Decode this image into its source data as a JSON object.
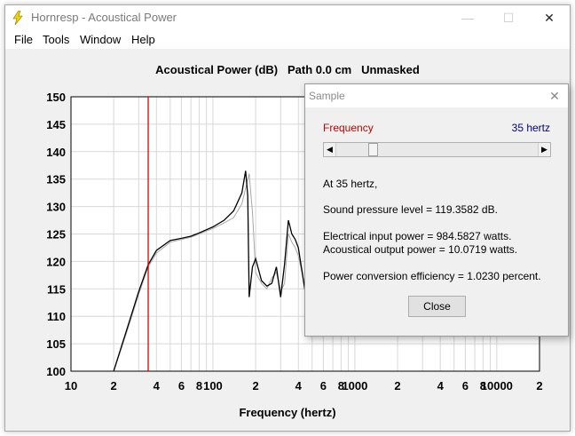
{
  "window": {
    "title": "Hornresp - Acoustical Power",
    "icon": "lightning-icon",
    "controls": {
      "minimize": "—",
      "maximize": "☐",
      "close": "✕"
    }
  },
  "menu": [
    "File",
    "Tools",
    "Window",
    "Help"
  ],
  "chart": {
    "title": "Acoustical Power (dB)   Path 0.0 cm   Unmasked",
    "xlabel": "Frequency (hertz)",
    "ylabel": "",
    "y_ticks": [
      "150",
      "145",
      "140",
      "135",
      "130",
      "125",
      "120",
      "115",
      "110",
      "105",
      "100"
    ],
    "x_ticks": [
      "10",
      "2",
      "4",
      "6",
      "8",
      "100",
      "2",
      "4",
      "6",
      "8",
      "1000",
      "2",
      "4",
      "6",
      "8",
      "10000",
      "2"
    ],
    "cursor_color": "#e00000"
  },
  "chart_data": {
    "type": "line",
    "title": "Acoustical Power (dB)   Path 0.0 cm   Unmasked",
    "xlabel": "Frequency (hertz)",
    "ylabel": "",
    "x_scale": "log",
    "xlim": [
      10,
      20000
    ],
    "ylim": [
      100,
      150
    ],
    "grid": true,
    "cursor_x": 35,
    "series": [
      {
        "color": "#000000",
        "x": [
          20,
          25,
          30,
          35,
          40,
          50,
          60,
          70,
          80,
          100,
          120,
          140,
          160,
          170,
          176,
          180,
          190,
          200,
          220,
          240,
          260,
          280,
          300,
          320,
          340,
          360,
          380,
          400,
          450,
          500
        ],
        "y": [
          100,
          108,
          114.5,
          119.4,
          122,
          123.8,
          124.2,
          124.6,
          125.2,
          126.3,
          127.5,
          129.2,
          132.5,
          136.5,
          132,
          113.5,
          119,
          120.5,
          116.5,
          115.5,
          116,
          119,
          113.5,
          119.5,
          127.5,
          125,
          124,
          122.5,
          114,
          108
        ]
      },
      {
        "color": "#a8a8a8",
        "x": [
          20,
          25,
          30,
          35,
          40,
          50,
          60,
          70,
          80,
          100,
          120,
          140,
          160,
          180,
          190,
          200,
          220,
          240,
          260,
          280,
          300,
          320,
          340,
          360,
          380,
          400,
          450,
          500
        ],
        "y": [
          100,
          107.5,
          114,
          119,
          121.5,
          123.5,
          124,
          124.4,
          125,
          126,
          127,
          128,
          130.5,
          136,
          129,
          118,
          116,
          115,
          117,
          118,
          114.5,
          116,
          125,
          123.5,
          122.5,
          121,
          115,
          109
        ]
      }
    ]
  },
  "dialog": {
    "title": "Sample",
    "frequency_label": "Frequency",
    "frequency_value": "35 hertz",
    "slider_value_hz": 35,
    "at_line": "At 35 hertz,",
    "spl_line": "Sound pressure level = 119.3582 dB.",
    "input_power_line": "Electrical input power = 984.5827 watts.",
    "output_power_line": "Acoustical output power = 10.0719 watts.",
    "efficiency_line": "Power conversion efficiency = 1.0230 percent.",
    "close_label": "Close"
  }
}
